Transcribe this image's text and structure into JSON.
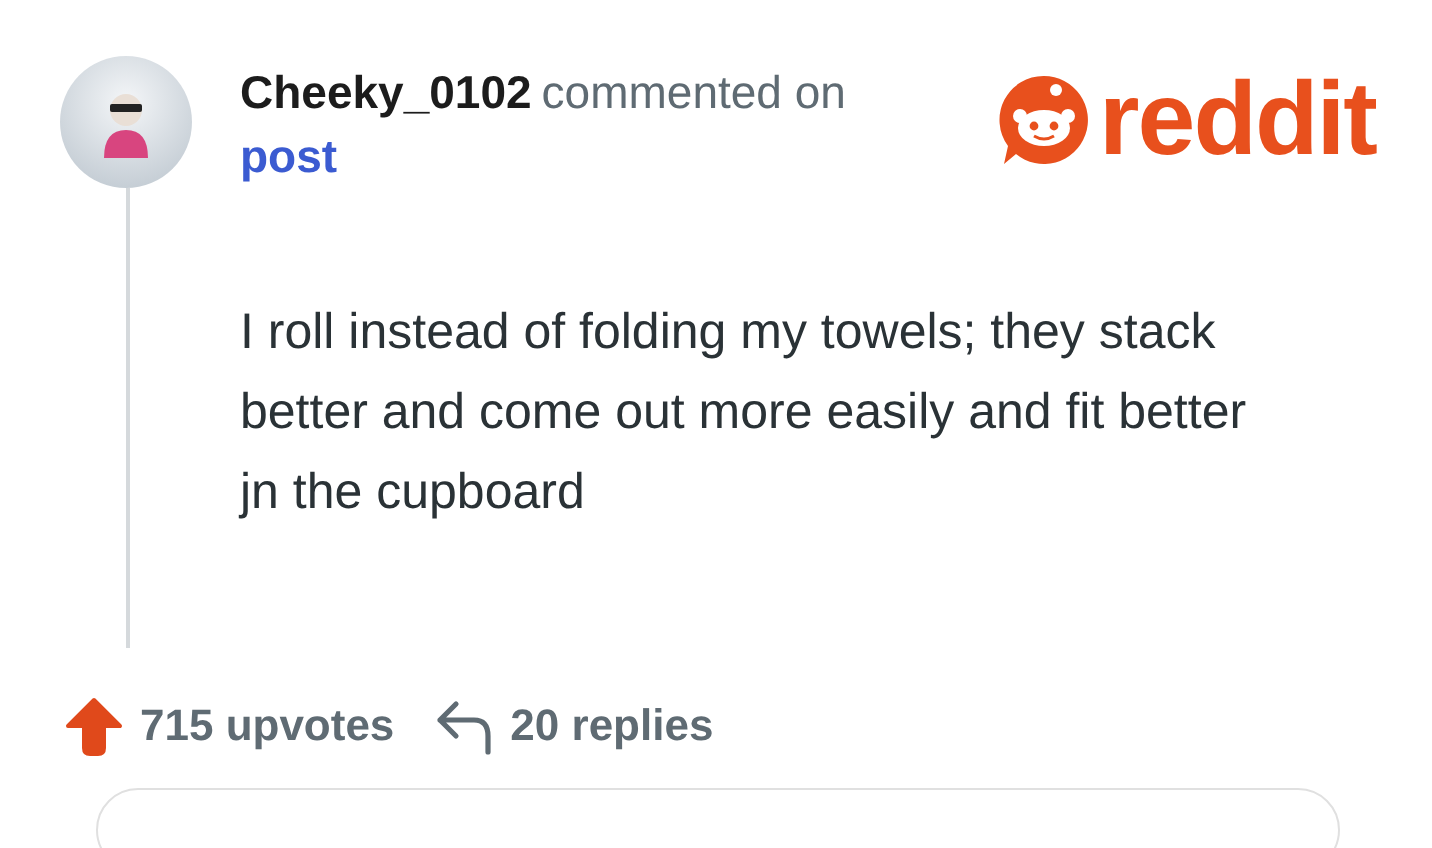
{
  "comment": {
    "author": "Cheeky_0102",
    "action": "commented on",
    "target": "post",
    "body": "I roll instead of folding my towels; they stack better and come out more easily and fit better jn the cupboard"
  },
  "logo": {
    "wordmark": "reddit"
  },
  "footer": {
    "upvoted": true,
    "upvotes": "715 upvotes",
    "replies": "20 replies"
  }
}
